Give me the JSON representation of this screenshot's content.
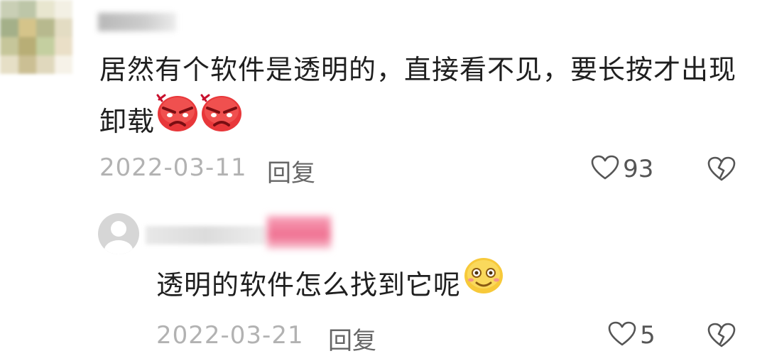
{
  "comments": [
    {
      "text": "居然有个软件是透明的，直接看不见，要长按才出现卸载",
      "emojis": [
        "angry-face-icon",
        "angry-face-icon"
      ],
      "date": "2022-03-11",
      "reply_label": "回复",
      "likes": "93"
    },
    {
      "text": "透明的软件怎么找到它呢",
      "emojis": [
        "smile-face-icon"
      ],
      "date": "2022-03-21",
      "reply_label": "回复",
      "likes": "5"
    }
  ],
  "colors": {
    "text": "#1f1f1f",
    "date": "#b2b2b2",
    "reply": "#666666",
    "angry_red": "#e8373a",
    "smile_yellow": "#f7c93a"
  }
}
